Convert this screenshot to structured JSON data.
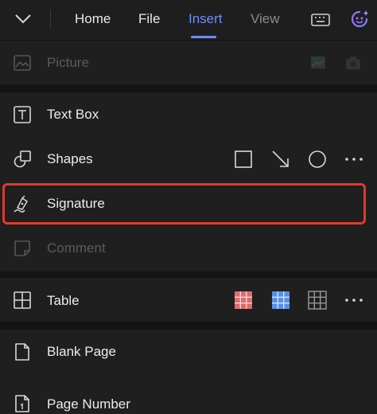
{
  "tabs": {
    "home": "Home",
    "file": "File",
    "insert": "Insert",
    "view": "View"
  },
  "active_tab": "Insert",
  "icons": {
    "collapse": "chevron-down-icon",
    "keyboard": "keyboard-icon",
    "assistant": "ai-assistant-icon"
  },
  "menu": {
    "picture": {
      "label": "Picture",
      "enabled": false
    },
    "text_box": {
      "label": "Text Box"
    },
    "shapes": {
      "label": "Shapes",
      "quick": [
        "rectangle",
        "arrow",
        "circle",
        "more"
      ]
    },
    "signature": {
      "label": "Signature",
      "highlighted": true
    },
    "comment": {
      "label": "Comment",
      "enabled": false
    },
    "table": {
      "label": "Table",
      "quick": [
        "red-grid-table",
        "blue-grid-table",
        "plain-grid-table",
        "more"
      ]
    },
    "blank_page": {
      "label": "Blank Page"
    },
    "page_number": {
      "label": "Page Number"
    }
  },
  "colors": {
    "accent": "#6f8dff",
    "highlight_border": "#e0392b",
    "table_red": "#e06a6a",
    "table_blue": "#5b8fe6"
  }
}
